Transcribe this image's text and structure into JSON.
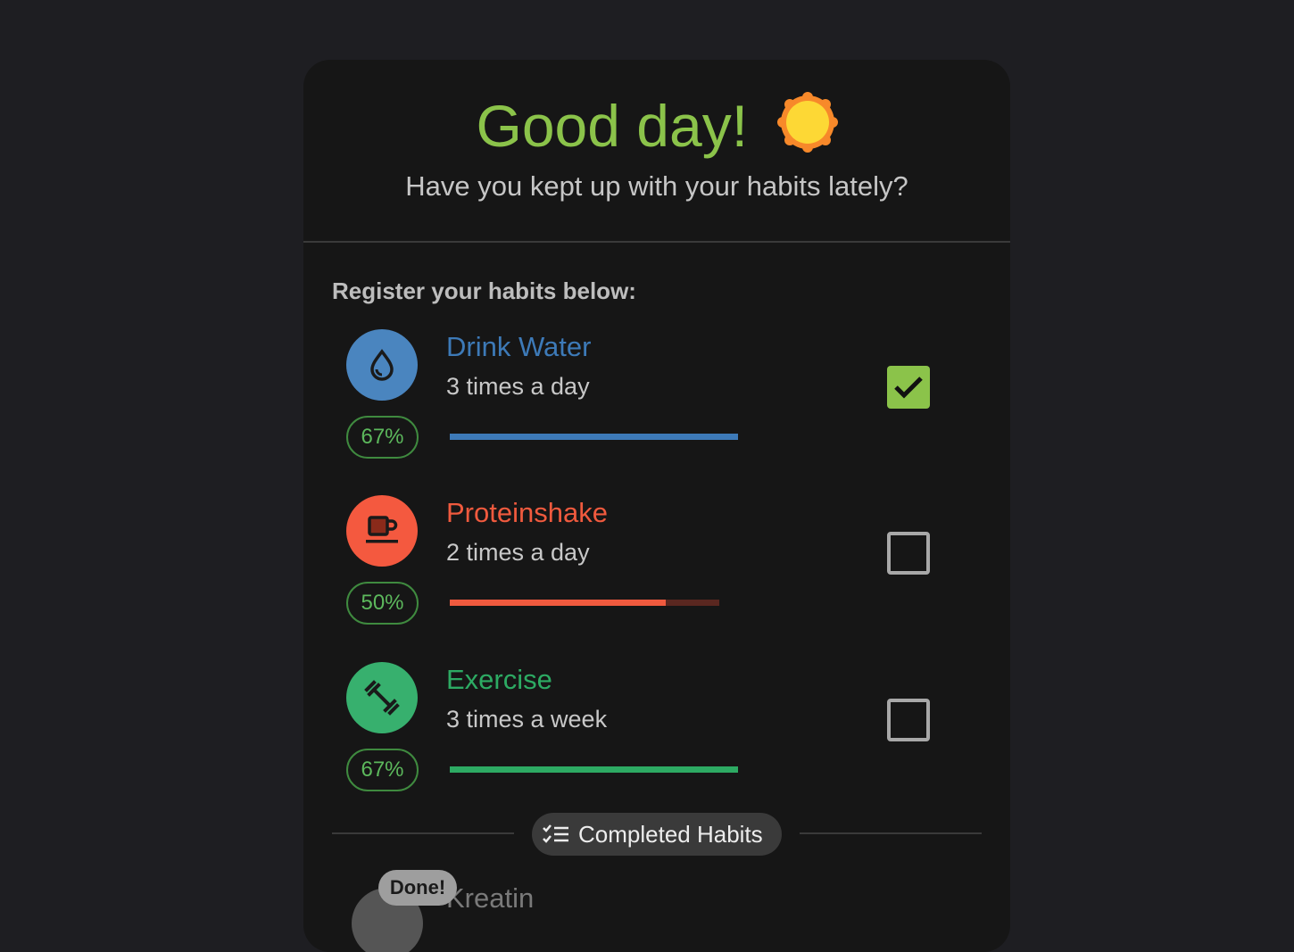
{
  "header": {
    "title": "Good day!",
    "subtitle": "Have you kept up with your habits lately?",
    "title_icon": "sun-icon"
  },
  "register": {
    "heading": "Register your habits below:"
  },
  "habits": [
    {
      "name": "Drink Water",
      "frequency": "3 times a day",
      "percent_label": "67%",
      "progress": 1.0,
      "checked": true,
      "icon": "water-drop-icon",
      "color": "#3d7ab8"
    },
    {
      "name": "Proteinshake",
      "frequency": "2 times a day",
      "percent_label": "50%",
      "progress": 0.8,
      "checked": false,
      "icon": "cup-icon",
      "color": "#f05a3e"
    },
    {
      "name": "Exercise",
      "frequency": "3 times a week",
      "percent_label": "67%",
      "progress": 1.0,
      "checked": false,
      "icon": "dumbbell-icon",
      "color": "#2daa63"
    }
  ],
  "completed_section": {
    "label": "Completed Habits",
    "icon": "checklist-icon"
  },
  "completed_habits": [
    {
      "badge": "Done!",
      "name": "Kreatin"
    }
  ],
  "colors": {
    "accent_green": "#8bc34a",
    "background": "#1e1e22",
    "card": "#161616"
  }
}
